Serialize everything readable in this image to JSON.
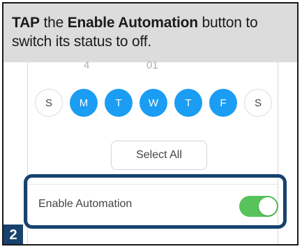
{
  "instruction": {
    "lead": "TAP",
    "text_mid": " the ",
    "button_name": "Enable Automation",
    "text_end": " button to switch its status to off."
  },
  "time_picker": {
    "hour": "4",
    "minute": "01"
  },
  "days": [
    {
      "label": "S",
      "selected": false
    },
    {
      "label": "M",
      "selected": true
    },
    {
      "label": "T",
      "selected": true
    },
    {
      "label": "W",
      "selected": true
    },
    {
      "label": "T",
      "selected": true
    },
    {
      "label": "F",
      "selected": true
    },
    {
      "label": "S",
      "selected": false
    }
  ],
  "select_all_label": "Select All",
  "enable_automation": {
    "label": "Enable Automation",
    "on": true
  },
  "step_number": "2",
  "colors": {
    "day_selected": "#1a9df3",
    "toggle_on": "#57c35a",
    "highlight": "#17426e",
    "instruction_bg": "#dcdcdc"
  }
}
